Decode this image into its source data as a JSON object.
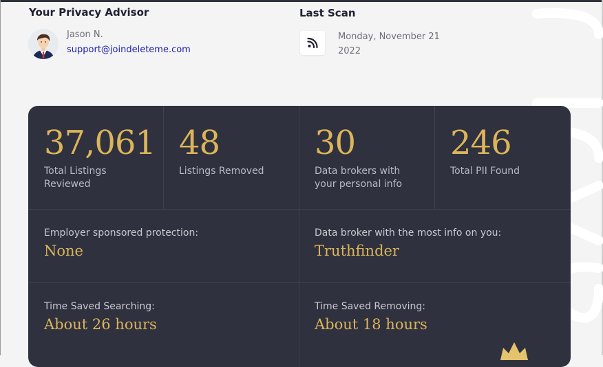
{
  "advisor": {
    "title": "Your Privacy Advisor",
    "name": "Jason N.",
    "email": "support@joindeleteme.com"
  },
  "last_scan": {
    "title": "Last Scan",
    "date_line1": "Monday, November 21",
    "date_line2": "2022",
    "icon": "rss-icon"
  },
  "stats": [
    {
      "value": "37,061",
      "label_line1": "Total Listings",
      "label_line2": "Reviewed"
    },
    {
      "value": "48",
      "label_line1": "Listings Removed",
      "label_line2": ""
    },
    {
      "value": "30",
      "label_line1": "Data brokers with",
      "label_line2": "your personal info"
    },
    {
      "value": "246",
      "label_line1": "Total PII Found",
      "label_line2": ""
    }
  ],
  "info": [
    {
      "label": "Employer sponsored protection:",
      "value": "None"
    },
    {
      "label": "Data broker with the most info on you:",
      "value": "Truthfinder"
    },
    {
      "label": "Time Saved Searching:",
      "value": "About 26 hours"
    },
    {
      "label": "Time Saved Removing:",
      "value": "About 18 hours"
    }
  ],
  "colors": {
    "panel_bg": "#2f313e",
    "accent_gold": "#dcb45a",
    "link_blue": "#1b1fb0",
    "page_bg": "#f4f4f4"
  }
}
